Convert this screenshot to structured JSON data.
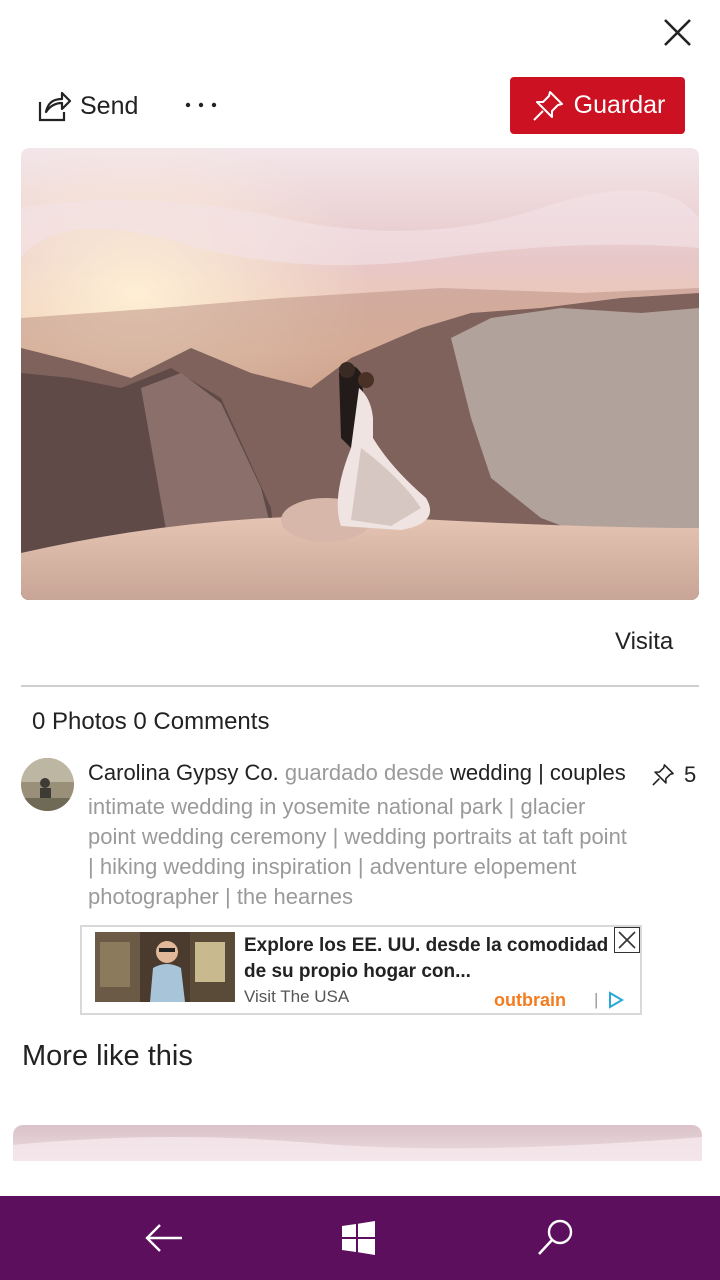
{
  "toolbar": {
    "send_label": "Send",
    "save_label": "Guardar",
    "save_color": "#cc1122"
  },
  "pin": {
    "visit_label": "Visita",
    "counts": "0 Photos 0 Comments",
    "author": "Carolina Gypsy Co.",
    "saved_from": "guardado desde",
    "board": "wedding | couples",
    "repin_count": "5",
    "description": "intimate wedding in yosemite national park | glacier point wedding ceremony | wedding portraits at taft point | hiking wedding inspiration | adventure elopement photographer | the hearnes"
  },
  "ad": {
    "title": "Explore los EE. UU. desde la comodidad de su propio hogar con...",
    "source": "Visit The USA",
    "brand": "Outbrain",
    "brand_color": "#f47c20",
    "separator": "|"
  },
  "more": {
    "heading": "More like this"
  },
  "navbar": {
    "color": "#5b0f5c",
    "icons": [
      "back-arrow-icon",
      "windows-start-icon",
      "search-icon"
    ]
  }
}
